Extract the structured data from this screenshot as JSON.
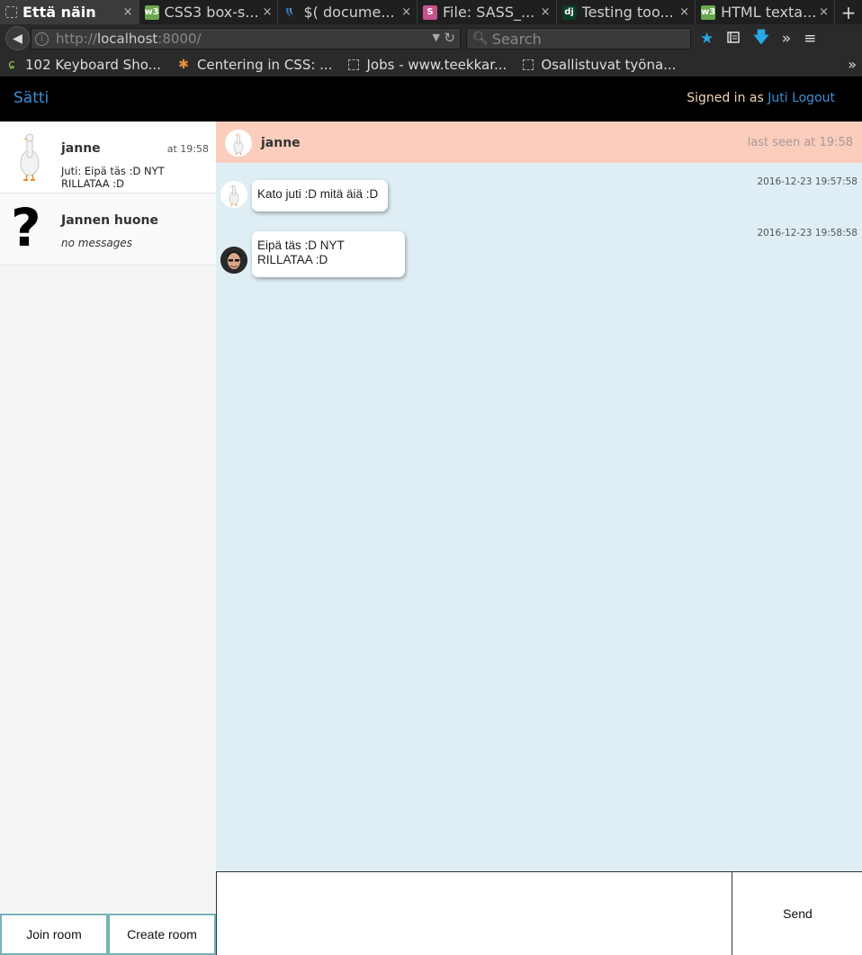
{
  "browser": {
    "tabs": [
      {
        "title": "Että näin",
        "active": true,
        "icon": "dashed-box-icon"
      },
      {
        "title": "CSS3 box-s...",
        "active": false,
        "icon": "w3-icon"
      },
      {
        "title": "$( docume...",
        "active": false,
        "icon": "jquery-icon"
      },
      {
        "title": "File: SASS_...",
        "active": false,
        "icon": "sass-icon"
      },
      {
        "title": "Testing too...",
        "active": false,
        "icon": "django-icon"
      },
      {
        "title": "HTML texta...",
        "active": false,
        "icon": "w3-icon"
      }
    ],
    "close_glyph": "×",
    "new_tab_glyph": "+",
    "url_prefix": "http://",
    "url_host": "localhost",
    "url_suffix": ":8000/",
    "search_placeholder": "Search",
    "bookmarks": [
      {
        "label": "102 Keyboard Sho...",
        "icon": "plant-icon"
      },
      {
        "label": "Centering in CSS: ...",
        "icon": "asterisk-icon"
      },
      {
        "label": "Jobs - www.teekkar...",
        "icon": "dashed-box-icon"
      },
      {
        "label": "Osallistuvat työna...",
        "icon": "dashed-box-icon"
      }
    ],
    "bookmarks_more": "»",
    "accent_color": "#2aa7e6"
  },
  "app": {
    "brand": "Sätti",
    "signed_in_text": "Signed in as",
    "user": "Juti",
    "logout": "Logout",
    "link_color": "#3d8fd6"
  },
  "sidebar": {
    "rooms": [
      {
        "name": "janne",
        "time": "at 19:58",
        "preview": "Juti: Eipä täs :D NYT RILLATAA :D",
        "avatar": "goose-icon"
      },
      {
        "name": "Jannen huone",
        "time": "",
        "preview": "no messages",
        "avatar": "question-mark-icon"
      }
    ],
    "join_label": "Join room",
    "create_label": "Create room"
  },
  "chat": {
    "header_name": "janne",
    "last_seen": "last seen at 19:58",
    "header_color": "#fbcdbd",
    "background_color": "#dfeef5",
    "messages": [
      {
        "timestamp": "2016-12-23 19:57:58",
        "text": "Kato juti :D mitä äiä :D",
        "avatar": "goose-icon"
      },
      {
        "timestamp": "2016-12-23 19:58:58",
        "text": "Eipä täs :D NYT RILLATAA :D",
        "avatar": "user-photo-icon"
      }
    ],
    "input_placeholder": "",
    "send_label": "Send"
  }
}
